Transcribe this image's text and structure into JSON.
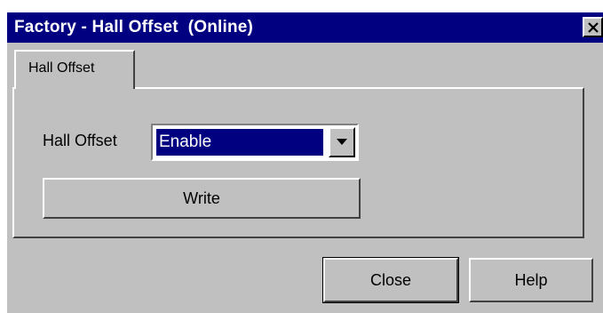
{
  "window": {
    "title": "Factory - Hall Offset  (Online)",
    "title_bar_color": "#000080",
    "close_icon": "close-x-icon"
  },
  "tabs": [
    {
      "label": "Hall Offset",
      "active": true
    }
  ],
  "form": {
    "hall_offset_label": "Hall Offset",
    "hall_offset_value": "Enable",
    "dropdown_icon": "chevron-down-icon",
    "write_label": "Write"
  },
  "footer": {
    "close_label": "Close",
    "help_label": "Help"
  },
  "colors": {
    "face": "#c0c0c0",
    "selection": "#000080"
  }
}
